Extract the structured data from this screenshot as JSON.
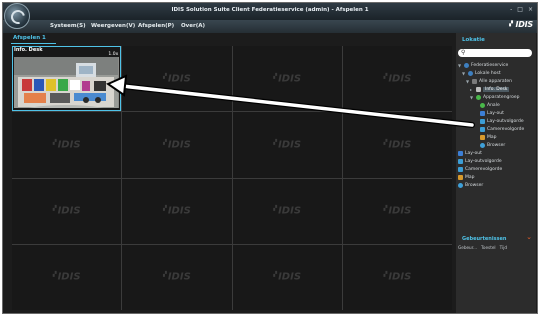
{
  "window": {
    "title": "IDIS Solution Suite Client Federatieservice (admin) - Afspelen 1",
    "controls": [
      "-",
      "□",
      "×"
    ]
  },
  "menubar": {
    "items": [
      {
        "label": "Systeem(S)",
        "icon": "menu"
      },
      {
        "label": "Weergeven(V)",
        "icon": "menu"
      },
      {
        "label": "Afspelen(P)",
        "icon": "menu"
      },
      {
        "label": "Over(A)",
        "icon": "menu"
      }
    ],
    "brand": "IDIS"
  },
  "tabs": [
    {
      "label": "Afspelen 1"
    }
  ],
  "grid": {
    "logo_text": "IDIS",
    "active_camera": {
      "name": "Info. Desk",
      "rate": "1.0x"
    }
  },
  "sidebar": {
    "header": "Lokatie",
    "search_placeholder": "",
    "tree": [
      {
        "label": "Federatieservice",
        "icon": "globe-icon",
        "indent": 0
      },
      {
        "label": "Lokale host",
        "icon": "globe-icon",
        "indent": 1
      },
      {
        "label": "Alle apparaten",
        "icon": "camera-group-icon",
        "indent": 2
      },
      {
        "label": "Info. Desk",
        "icon": "camera-icon",
        "indent": 3,
        "selected": true
      },
      {
        "label": "Apparatengroep",
        "icon": "device-group-icon",
        "indent": 1
      },
      {
        "label": "Anale",
        "icon": "analog-icon",
        "indent": 2
      },
      {
        "label": "Lay-out",
        "icon": "layout-icon",
        "indent": 2
      },
      {
        "label": "Lay-outvolgorde",
        "icon": "sequence-icon",
        "indent": 2
      },
      {
        "label": "Camerevolgorde",
        "icon": "sequence-icon",
        "indent": 2
      },
      {
        "label": "Map",
        "icon": "map-icon",
        "indent": 2
      },
      {
        "label": "Browser",
        "icon": "browser-icon",
        "indent": 2
      },
      {
        "label": "Lay-out",
        "icon": "layout-icon",
        "indent": 0
      },
      {
        "label": "Lay-outvolgorde",
        "icon": "sequence-icon",
        "indent": 0
      },
      {
        "label": "Camerevolgorde",
        "icon": "sequence-icon",
        "indent": 0
      },
      {
        "label": "Map",
        "icon": "map-icon",
        "indent": 0
      },
      {
        "label": "Browser",
        "icon": "browser-icon",
        "indent": 0
      }
    ],
    "events": {
      "title": "Gebeurtenissen",
      "columns": [
        "Gebeur...",
        "Toestel",
        "Tijd"
      ]
    }
  },
  "colors": {
    "accent": "#4fc3e8",
    "window_bg": "#1c1c1c",
    "sidebar_bg": "#2c2c2c",
    "event_chevron": "#e85d2a"
  }
}
